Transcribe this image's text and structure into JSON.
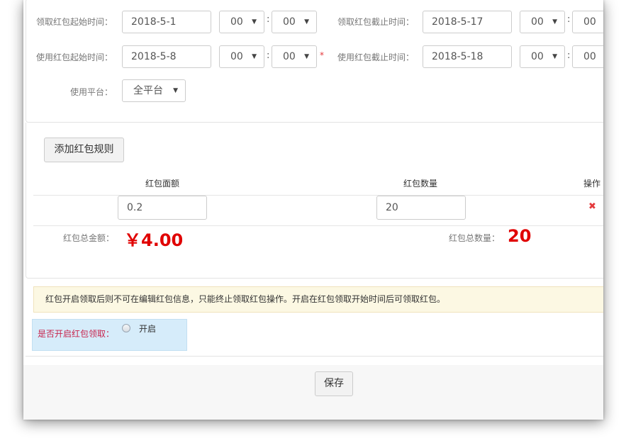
{
  "form": {
    "row_clipped": {
      "label_left": "领取红包起始时间：",
      "date_left": "2018-5-1",
      "hour_left": "00",
      "min_left": "00",
      "label_right": "领取红包截止时间：",
      "date_right": "2018-5-17",
      "hour_right": "00",
      "min_right": "00"
    },
    "row_use": {
      "label_left": "使用红包起始时间：",
      "date_left": "2018-5-8",
      "hour_left": "00",
      "min_left": "00",
      "required_mark": "*",
      "label_right": "使用红包截止时间：",
      "date_right": "2018-5-18",
      "hour_right": "00",
      "min_right": "00"
    },
    "colon": ":",
    "platform": {
      "label": "使用平台：",
      "value": "全平台"
    }
  },
  "rules": {
    "add_button": "添加红包规则",
    "headers": {
      "amount": "红包面额",
      "count": "红包数量",
      "action": "操作"
    },
    "rows": [
      {
        "amount": "0.2",
        "count": "20",
        "delete_icon": "✖"
      }
    ],
    "total_amount_label": "红包总金额：",
    "total_amount_value": "￥4.00",
    "total_count_label": "红包总数量：",
    "total_count_value": "20"
  },
  "notice": {
    "text": "红包开启领取后则不可在编辑红包信息，只能终止领取红包操作。开启在红包领取开始时间后可领取红包。"
  },
  "toggle": {
    "label": "是否开启红包领取：",
    "option": "开启"
  },
  "footer": {
    "save_button": "保存"
  },
  "colors": {
    "accent_red": "#e00000",
    "label_pink": "#c7254e",
    "notice_bg": "#fcf8e3",
    "highlight_bg": "#d6ecfa"
  }
}
